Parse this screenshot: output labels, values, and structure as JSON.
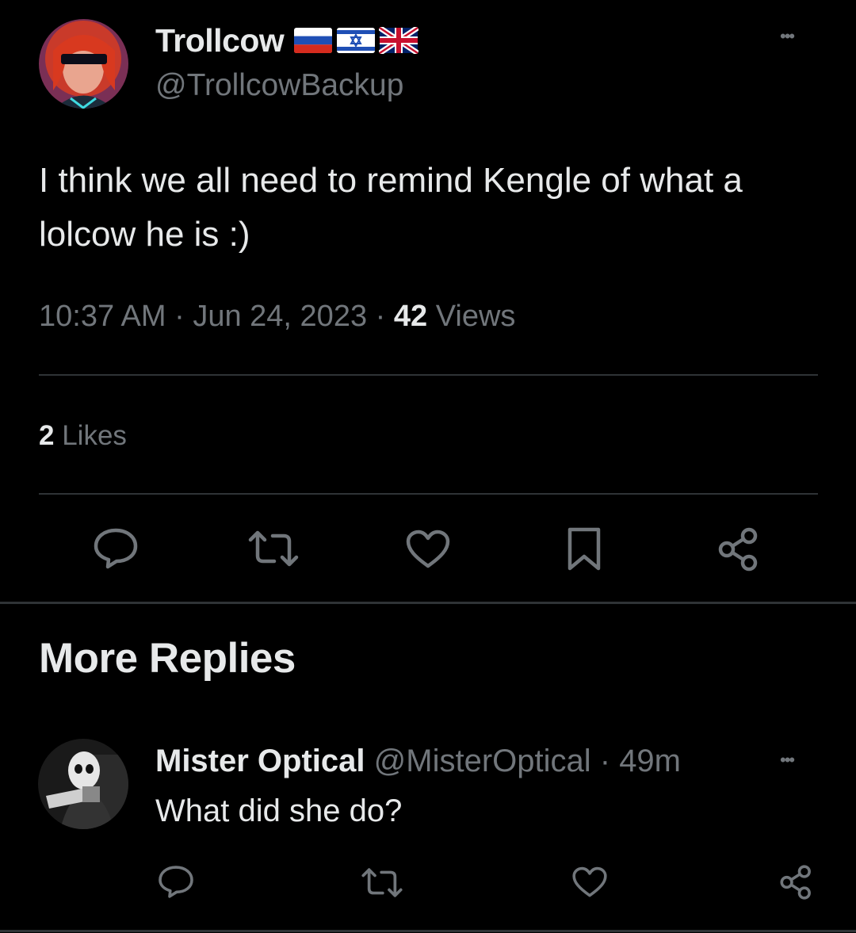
{
  "tweet": {
    "author_name": "Trollcow",
    "author_handle": "@TrollcowBackup",
    "flags": [
      "russia-flag-icon",
      "israel-flag-icon",
      "uk-flag-icon"
    ],
    "text": "I think we all need to remind Kengle of what a lolcow he is :)",
    "time": "10:37 AM",
    "date": "Jun 24, 2023",
    "views_count": "42",
    "views_label": "Views",
    "likes_count": "2",
    "likes_label": "Likes",
    "more_glyph": "•••"
  },
  "section_title": "More Replies",
  "reply": {
    "author_name": "Mister Optical",
    "author_handle": "@MisterOptical",
    "time_ago": "49m",
    "text": "What did she do?",
    "more_glyph": "•••"
  },
  "colors": {
    "background": "#000000",
    "text": "#e7e9ea",
    "muted": "#71767b",
    "divider": "#2f3336"
  }
}
